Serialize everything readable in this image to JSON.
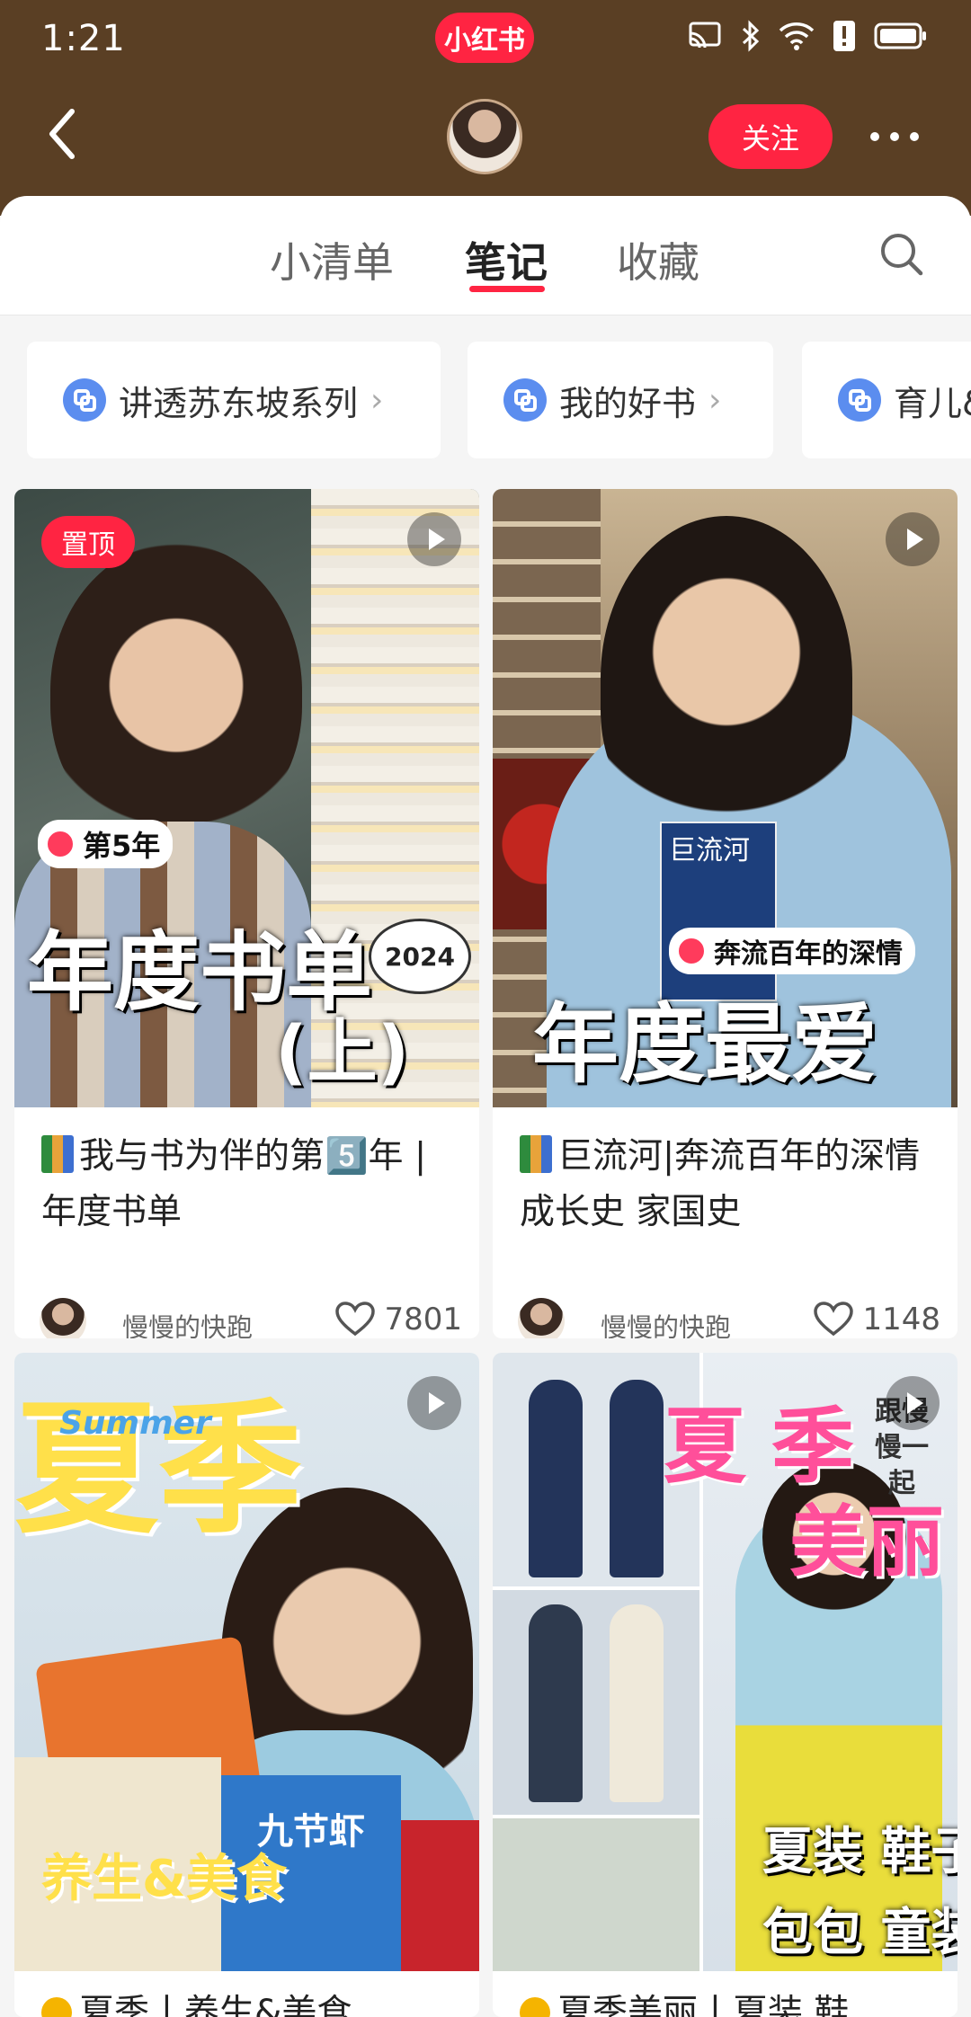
{
  "status_bar": {
    "time": "1:21",
    "brand": "小红书"
  },
  "nav": {
    "follow_label": "关注"
  },
  "tabs": [
    {
      "label": "小清单",
      "active": false
    },
    {
      "label": "笔记",
      "active": true
    },
    {
      "label": "收藏",
      "active": false
    }
  ],
  "collections": [
    {
      "label": "讲透苏东坡系列"
    },
    {
      "label": "我的好书"
    },
    {
      "label": "育儿&"
    }
  ],
  "notes": [
    {
      "pinned_label": "置顶",
      "sticker": "第5年",
      "cover_big": "年度书单",
      "cover_sub": "(上)",
      "cover_year": "2024",
      "title": "我与书为伴的第5️⃣年 | 年度书单",
      "author": "慢慢的快跑",
      "likes": "7801"
    },
    {
      "sticker": "奔流百年的深情",
      "cover_book": "巨流河",
      "cover_big": "年度最爱",
      "title": "巨流河|奔流百年的深情 成长史 家国史",
      "author": "慢慢的快跑",
      "likes": "1148"
    },
    {
      "cover_big": "夏季",
      "cover_tag": "Summer",
      "cover_bottom": "养生&美食",
      "cover_pack": "九节虾",
      "title": "夏季丨养生&美食"
    },
    {
      "cover_big1": "夏",
      "cover_big2": "季",
      "cover_small": "跟慢慢一起",
      "cover_big3": "美丽",
      "cover_bottom1": "夏装  鞋子",
      "cover_bottom2": "包包  童装",
      "title": "夏季美丽丨夏装 鞋"
    }
  ],
  "colors": {
    "header_bg": "#5a3f24",
    "accent": "#ff2442",
    "chip_icon": "#5b8def"
  }
}
